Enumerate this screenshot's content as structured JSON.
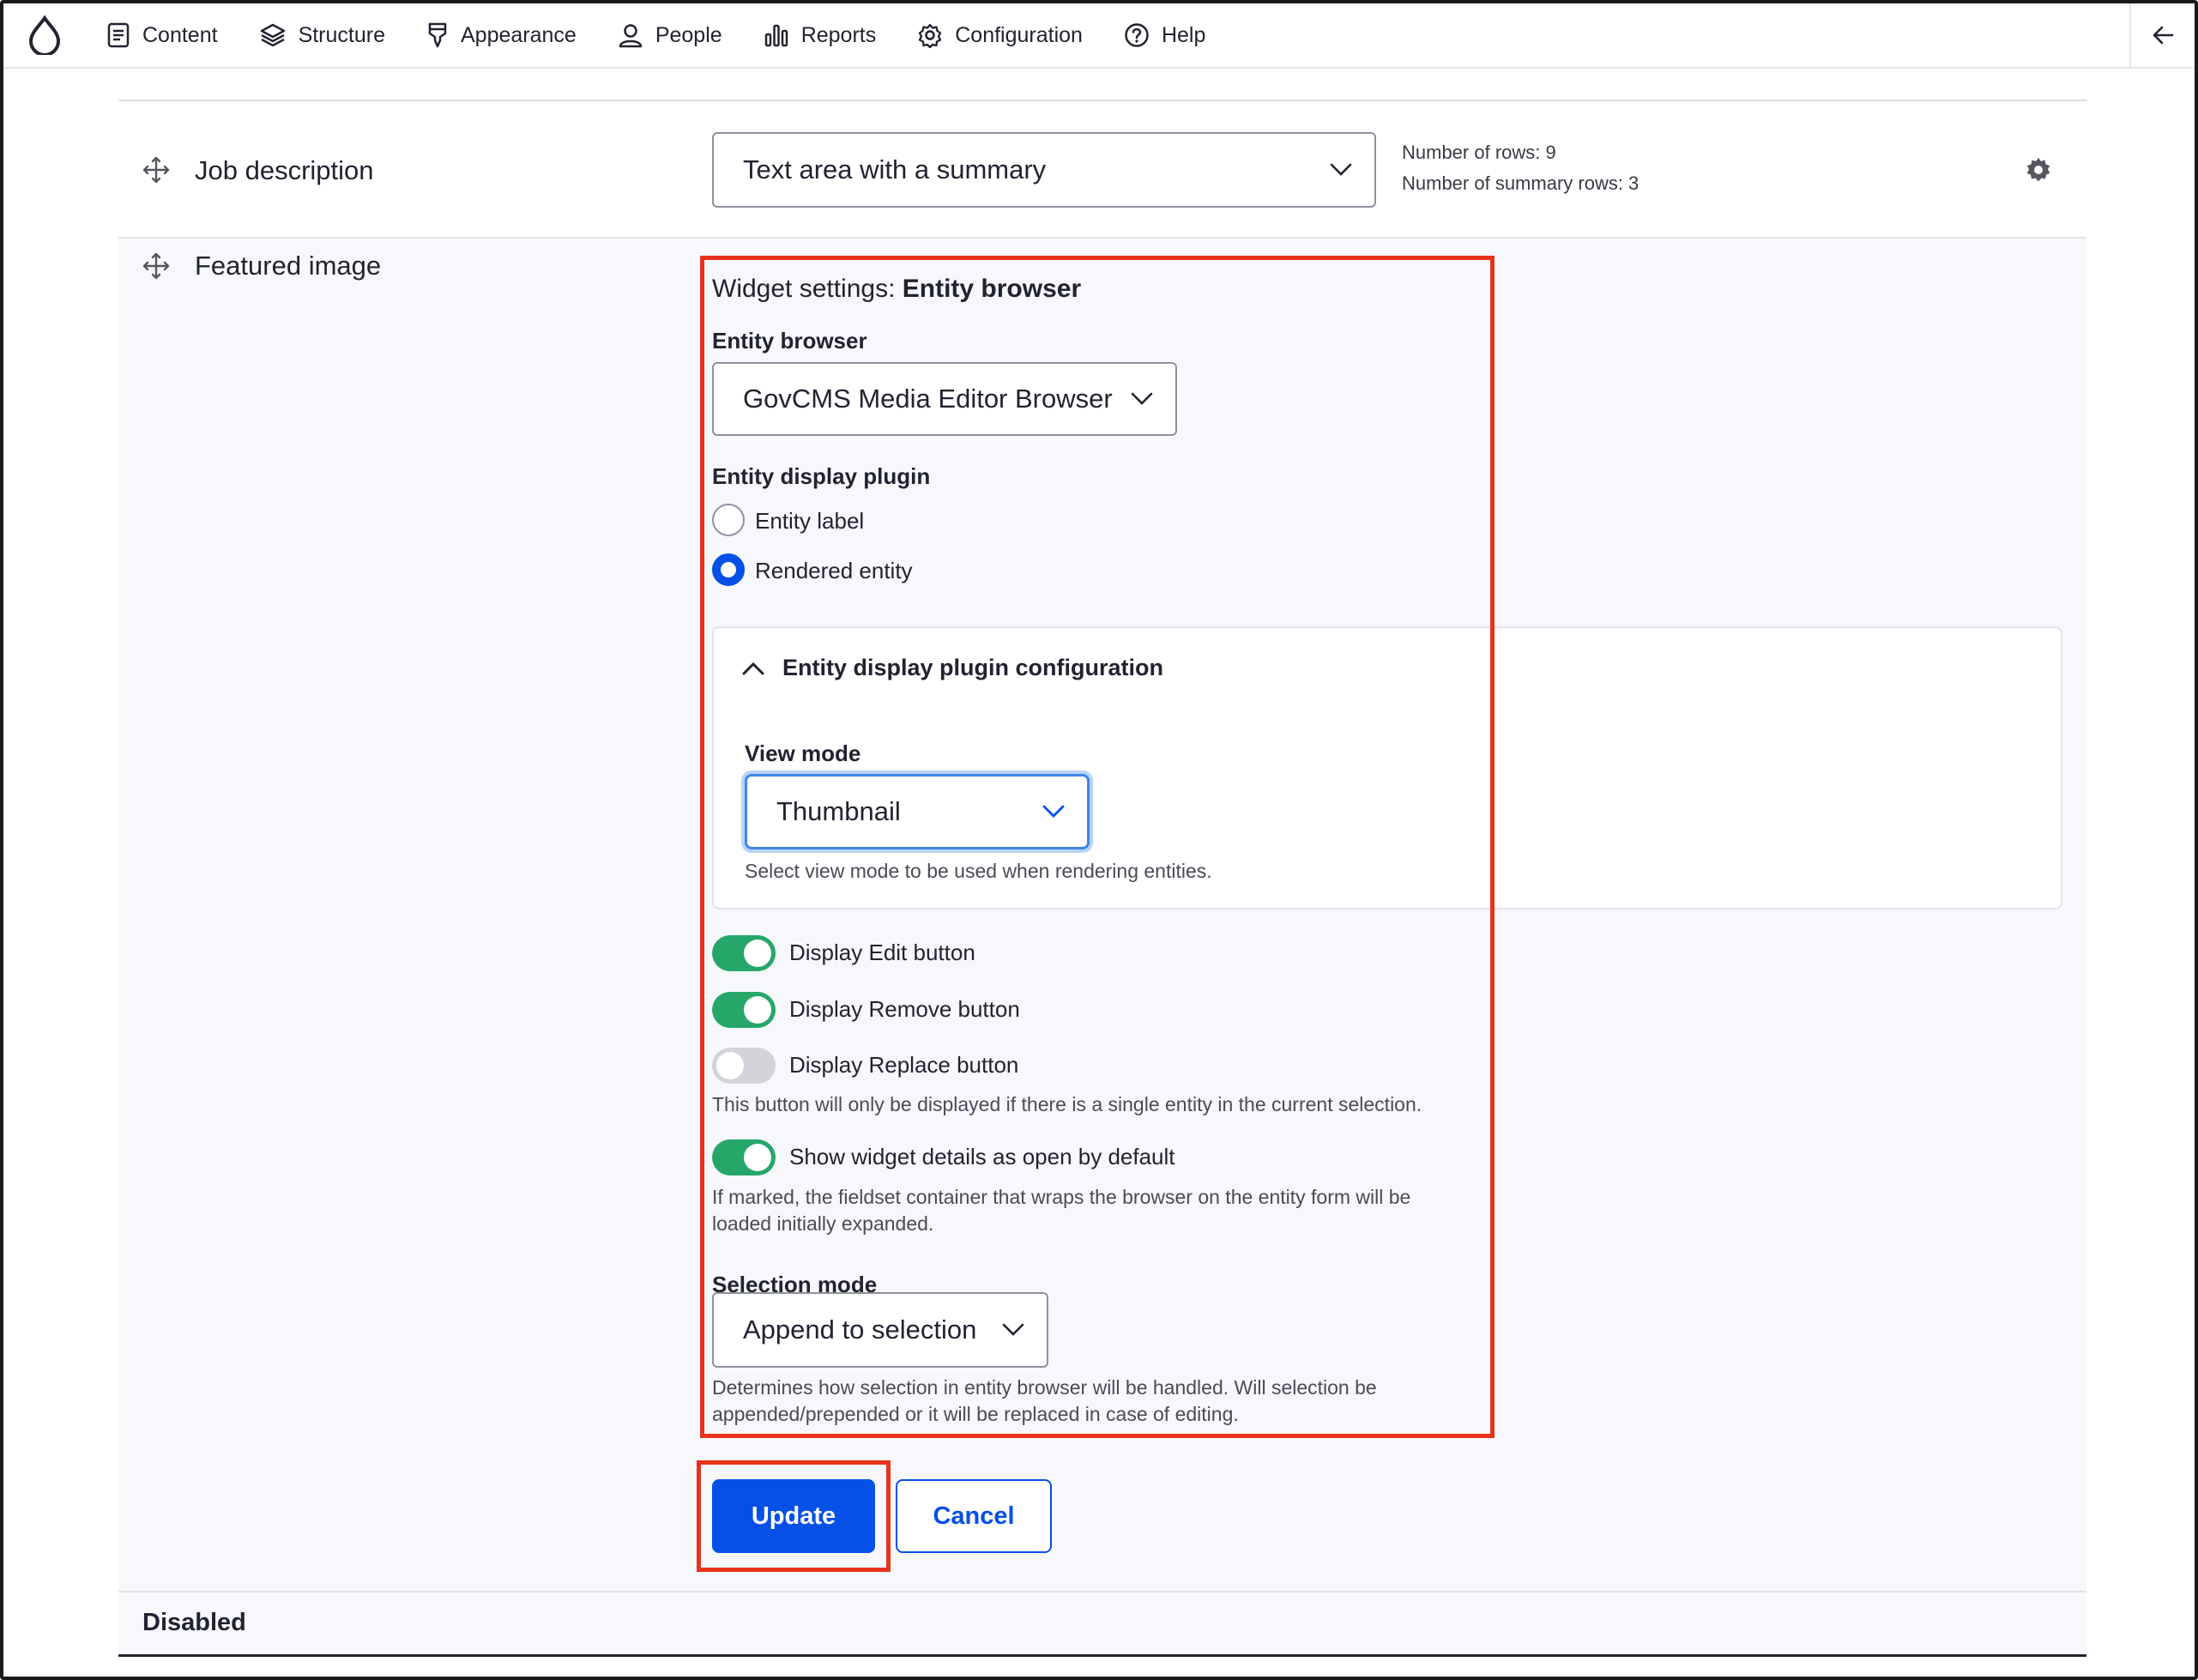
{
  "toolbar": {
    "items": [
      {
        "label": "Content",
        "icon": "content-icon"
      },
      {
        "label": "Structure",
        "icon": "structure-icon"
      },
      {
        "label": "Appearance",
        "icon": "appearance-icon"
      },
      {
        "label": "People",
        "icon": "people-icon"
      },
      {
        "label": "Reports",
        "icon": "reports-icon"
      },
      {
        "label": "Configuration",
        "icon": "configuration-icon"
      },
      {
        "label": "Help",
        "icon": "help-icon"
      }
    ]
  },
  "job_description": {
    "label": "Job description",
    "widget": "Text area with a summary",
    "summary_rows": "Number of rows: 9",
    "summary_summary_rows": "Number of summary rows: 3"
  },
  "featured_image": {
    "label": "Featured image",
    "widget_settings_prefix": "Widget settings: ",
    "widget_settings_name": "Entity browser",
    "entity_browser_label": "Entity browser",
    "entity_browser_value": "GovCMS Media Editor Browser",
    "display_plugin_label": "Entity display plugin",
    "display_plugin_options": [
      {
        "label": "Entity label",
        "checked": false
      },
      {
        "label": "Rendered entity",
        "checked": true
      }
    ],
    "config_title": "Entity display plugin configuration",
    "view_mode_label": "View mode",
    "view_mode_value": "Thumbnail",
    "view_mode_desc": "Select view mode to be used when rendering entities.",
    "toggles": [
      {
        "label": "Display Edit button",
        "on": true
      },
      {
        "label": "Display Remove button",
        "on": true
      },
      {
        "label": "Display Replace button",
        "on": false
      },
      {
        "label": "Show widget details as open by default",
        "on": true
      }
    ],
    "replace_desc": "This button will only be displayed if there is a single entity in the current selection.",
    "open_desc_1": "If marked, the fieldset container that wraps the browser on the entity form will be",
    "open_desc_2": "loaded initially expanded.",
    "selection_mode_label": "Selection mode",
    "selection_mode_value": "Append to selection",
    "selection_desc_1": "Determines how selection in entity browser will be handled. Will selection be",
    "selection_desc_2": "appended/prepended or it will be replaced in case of editing.",
    "update_label": "Update",
    "cancel_label": "Cancel"
  },
  "disabled": {
    "label": "Disabled"
  },
  "colors": {
    "accent": "#0550e6",
    "toggle_on": "#26a769",
    "highlight": "#e8321c"
  }
}
